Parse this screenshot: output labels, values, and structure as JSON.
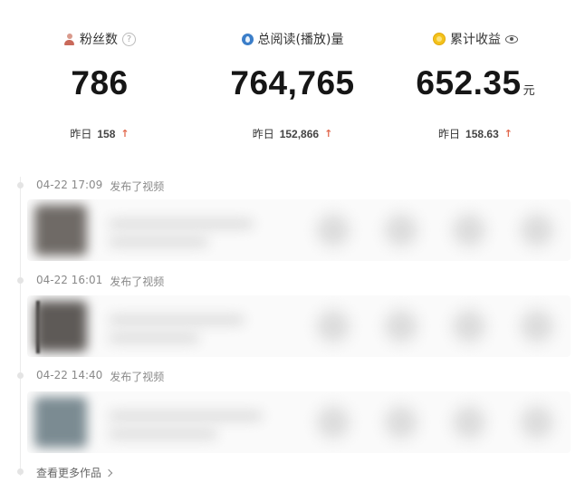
{
  "stats": [
    {
      "label": "粉丝数",
      "icon": "fans-person-icon",
      "value": "786",
      "unit": "",
      "yesterday_label": "昨日",
      "yesterday_value": "158"
    },
    {
      "label": "总阅读(播放)量",
      "icon": "reads-drop-icon",
      "value": "764,765",
      "unit": "",
      "yesterday_label": "昨日",
      "yesterday_value": "152,866"
    },
    {
      "label": "累计收益",
      "icon": "earnings-coin-icon",
      "value": "652.35",
      "unit": "元",
      "yesterday_label": "昨日",
      "yesterday_value": "158.63"
    }
  ],
  "trend_arrow": "🠙",
  "help_glyph": "?",
  "posts": [
    {
      "time": "04-22 17:09",
      "action": "发布了视频",
      "thumb_color": "#6f6a66"
    },
    {
      "time": "04-22 16:01",
      "action": "发布了视频",
      "thumb_color": "#5e5a57"
    },
    {
      "time": "04-22 14:40",
      "action": "发布了视频",
      "thumb_color": "#7b8b92"
    }
  ],
  "more_link": "查看更多作品",
  "colors": {
    "accent_up": "#e26a4f",
    "muted_text": "#8a8a8a"
  }
}
